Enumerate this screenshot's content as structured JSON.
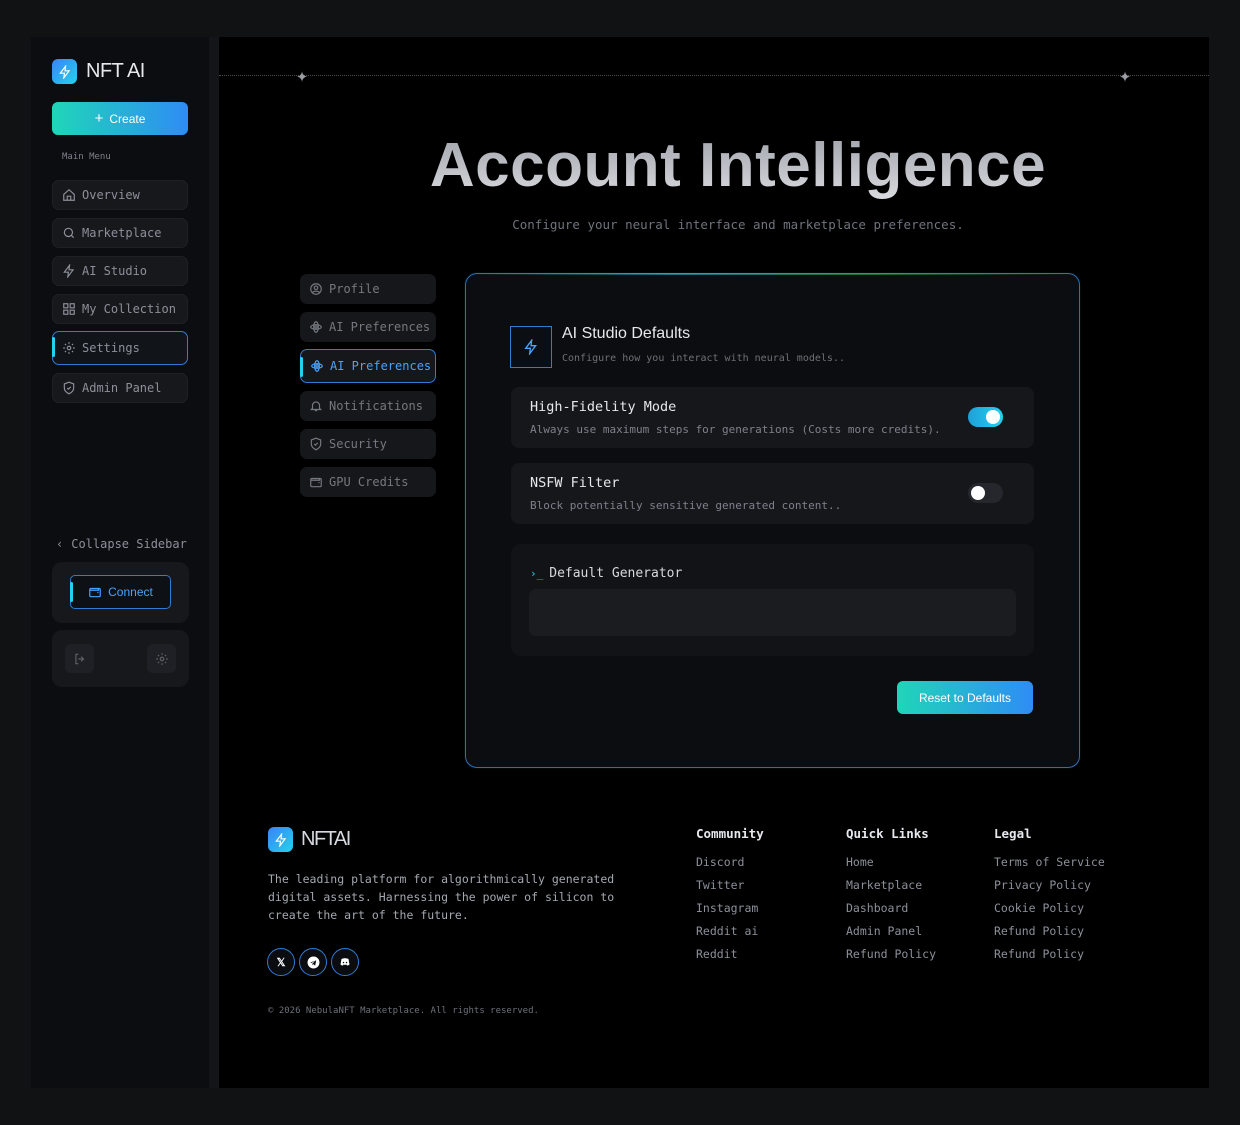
{
  "brand": {
    "name": "NFT AI",
    "footer_name": "NFTAI"
  },
  "sidebar": {
    "create_label": "Create",
    "menu_label": "Main Menu",
    "items": [
      {
        "label": "Overview",
        "icon": "home-icon"
      },
      {
        "label": "Marketplace",
        "icon": "search-icon"
      },
      {
        "label": "AI Studio",
        "icon": "lightning-icon"
      },
      {
        "label": "My Collection",
        "icon": "grid-icon"
      },
      {
        "label": "Settings",
        "icon": "gear-icon"
      },
      {
        "label": "Admin Panel",
        "icon": "shield-icon"
      }
    ],
    "collapse_label": "Collapse Sidebar",
    "connect_label": "Connect"
  },
  "header": {
    "title": "Account Intelligence",
    "subtitle": "Configure your neural interface and marketplace preferences."
  },
  "tabs": [
    {
      "label": "Profile",
      "icon": "user-circle-icon"
    },
    {
      "label": "AI Preferences",
      "icon": "atom-icon"
    },
    {
      "label": "AI Preferences",
      "icon": "atom-icon"
    },
    {
      "label": "Notifications",
      "icon": "bell-icon"
    },
    {
      "label": "Security",
      "icon": "shield-icon"
    },
    {
      "label": "GPU Credits",
      "icon": "wallet-icon"
    }
  ],
  "panel": {
    "title": "AI Studio Defaults",
    "subtitle": "Configure how you interact with neural models..",
    "settings": [
      {
        "title": "High-Fidelity Mode",
        "description": "Always use maximum steps for generations (Costs more credits).",
        "enabled": true
      },
      {
        "title": "NSFW Filter",
        "description": "Block potentially sensitive generated content..",
        "enabled": false
      }
    ],
    "generator_label": "Default Generator",
    "generator_value": "",
    "reset_label": "Reset to Defaults"
  },
  "footer": {
    "description": "The leading platform for algorithmically generated digital assets. Harnessing the power of silicon to create the art of the future.",
    "socials": [
      "x-icon",
      "telegram-icon",
      "discord-icon"
    ],
    "columns": [
      {
        "heading": "Community",
        "links": [
          "Discord",
          "Twitter",
          "Instagram",
          "Reddit ai",
          "Reddit"
        ]
      },
      {
        "heading": "Quick Links",
        "links": [
          "Home",
          "Marketplace",
          "Dashboard",
          "Admin Panel",
          "Refund Policy"
        ]
      },
      {
        "heading": "Legal",
        "links": [
          "Terms of Service",
          "Privacy Policy",
          "Cookie Policy",
          "Refund Policy",
          "Refund Policy"
        ]
      }
    ],
    "copyright": "© 2026 NebulaNFT Marketplace. All rights reserved."
  },
  "colors": {
    "accent_cyan": "#22d3ee",
    "accent_blue": "#2f8cf5",
    "accent_teal": "#1fd6b8",
    "background": "#000000"
  }
}
